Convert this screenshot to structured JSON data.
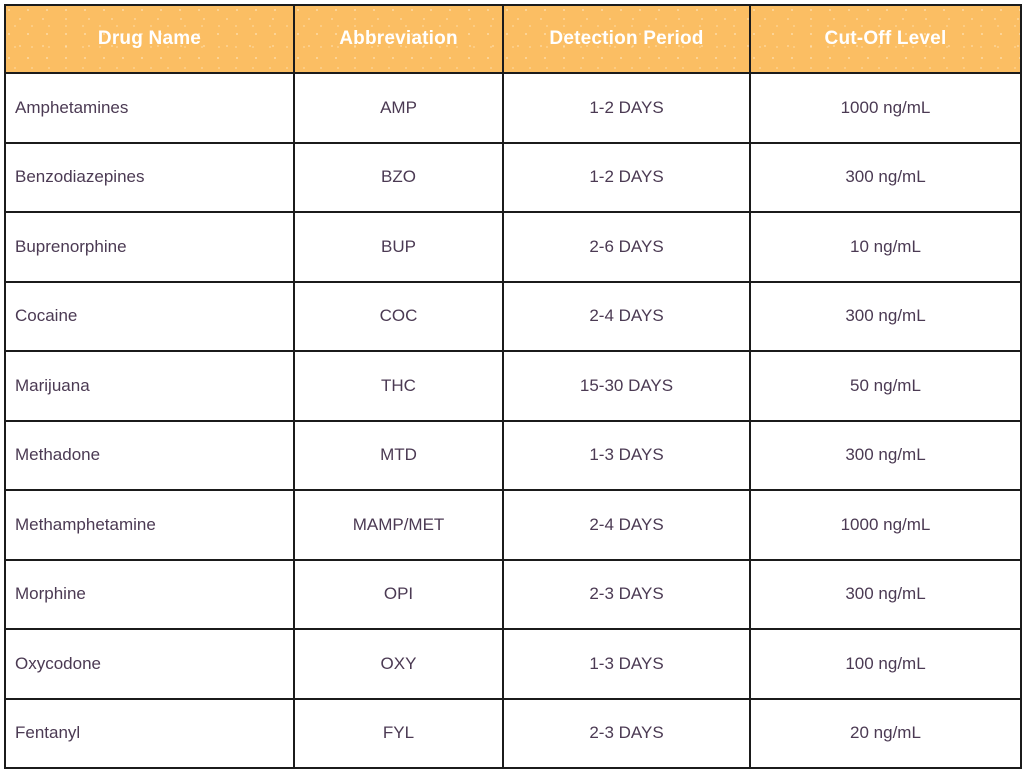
{
  "table": {
    "columns": [
      {
        "key": "drug_name",
        "label": "Drug Name",
        "align": "left"
      },
      {
        "key": "abbreviation",
        "label": "Abbreviation",
        "align": "center"
      },
      {
        "key": "detection_period",
        "label": "Detection Period",
        "align": "center"
      },
      {
        "key": "cut_off_level",
        "label": "Cut-Off Level",
        "align": "center"
      }
    ],
    "header_background": "#FBBE63",
    "header_text_color": "#FFFFFF",
    "body_text_color": "#4B3A53",
    "border_color": "#1B1B1B",
    "rows": [
      {
        "drug_name": "Amphetamines",
        "abbreviation": "AMP",
        "detection_period": "1-2 DAYS",
        "cut_off_level": "1000 ng/mL"
      },
      {
        "drug_name": "Benzodiazepines",
        "abbreviation": "BZO",
        "detection_period": "1-2 DAYS",
        "cut_off_level": "300 ng/mL"
      },
      {
        "drug_name": "Buprenorphine",
        "abbreviation": "BUP",
        "detection_period": "2-6 DAYS",
        "cut_off_level": "10 ng/mL"
      },
      {
        "drug_name": "Cocaine",
        "abbreviation": "COC",
        "detection_period": "2-4 DAYS",
        "cut_off_level": "300 ng/mL"
      },
      {
        "drug_name": "Marijuana",
        "abbreviation": "THC",
        "detection_period": "15-30 DAYS",
        "cut_off_level": "50 ng/mL"
      },
      {
        "drug_name": "Methadone",
        "abbreviation": "MTD",
        "detection_period": "1-3 DAYS",
        "cut_off_level": "300 ng/mL"
      },
      {
        "drug_name": "Methamphetamine",
        "abbreviation": "MAMP/MET",
        "detection_period": "2-4 DAYS",
        "cut_off_level": "1000 ng/mL"
      },
      {
        "drug_name": "Morphine",
        "abbreviation": "OPI",
        "detection_period": "2-3 DAYS",
        "cut_off_level": "300 ng/mL"
      },
      {
        "drug_name": "Oxycodone",
        "abbreviation": "OXY",
        "detection_period": "1-3 DAYS",
        "cut_off_level": "100 ng/mL"
      },
      {
        "drug_name": "Fentanyl",
        "abbreviation": "FYL",
        "detection_period": "2-3 DAYS",
        "cut_off_level": "20 ng/mL"
      }
    ]
  }
}
